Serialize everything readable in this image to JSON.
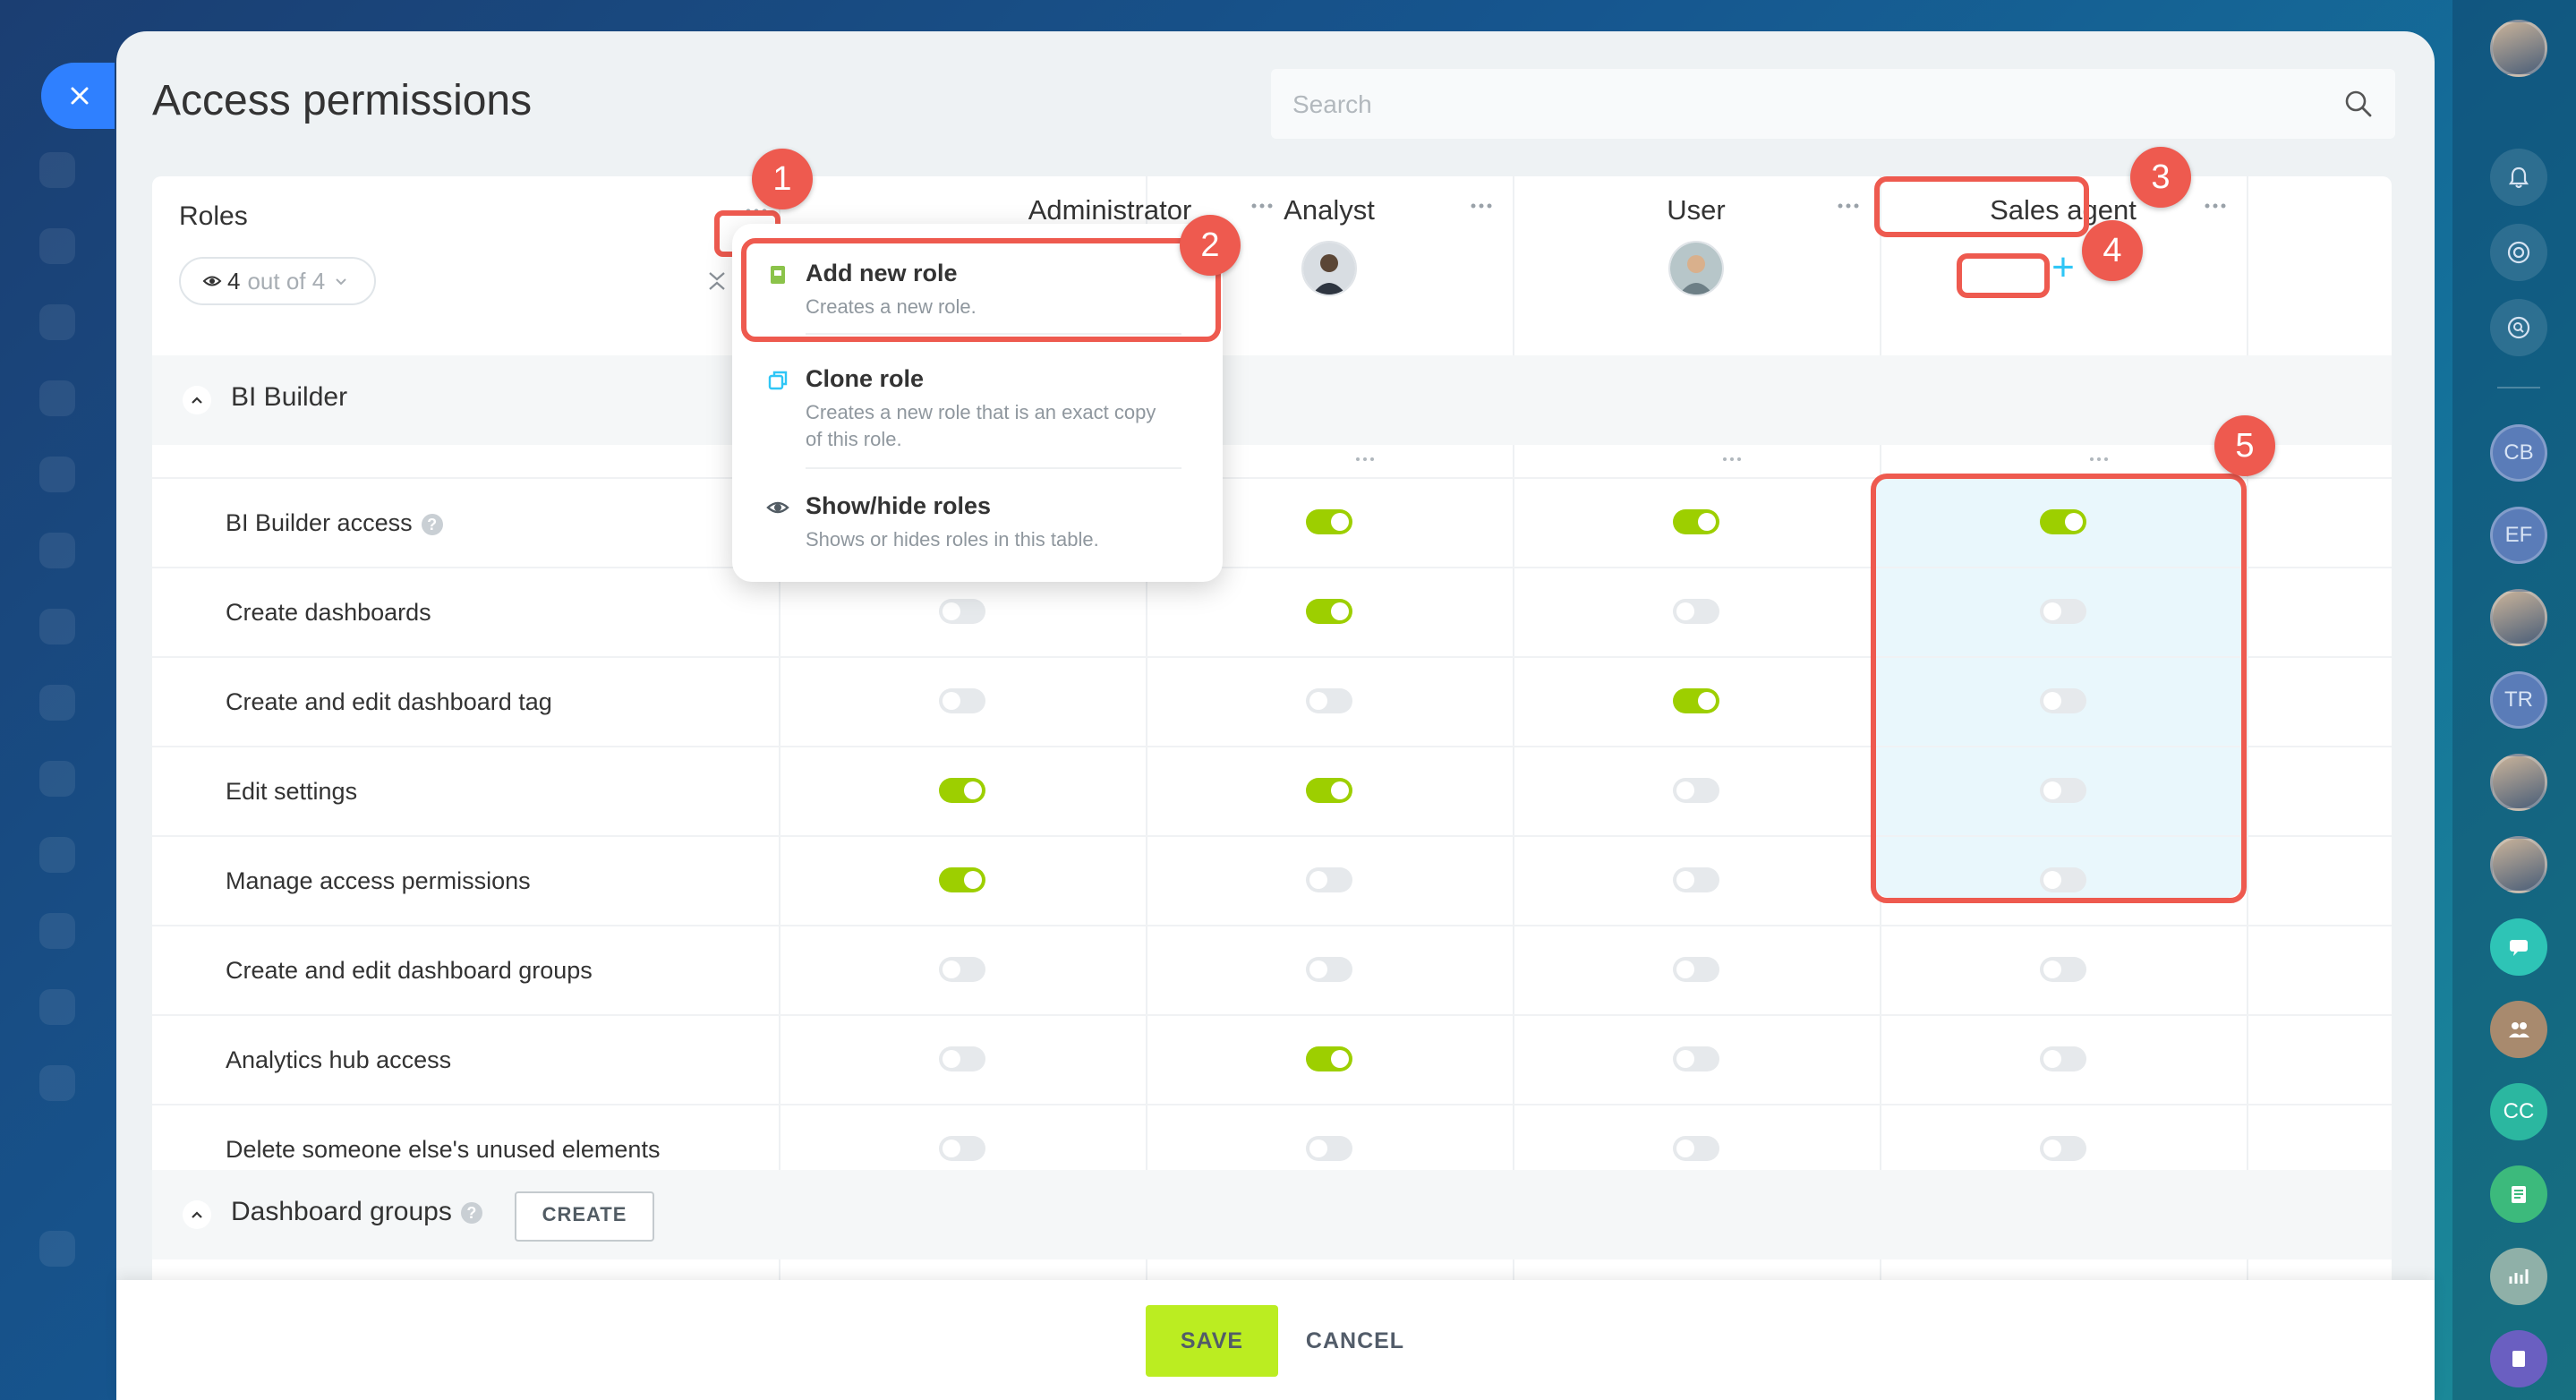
{
  "page": {
    "title": "Access permissions"
  },
  "search": {
    "placeholder": "Search"
  },
  "roles_header": {
    "label": "Roles",
    "count_num": "4",
    "count_rest": "out of 4"
  },
  "columns": [
    {
      "name": "Administrator"
    },
    {
      "name": "Analyst"
    },
    {
      "name": "User"
    },
    {
      "name": "Sales agent"
    }
  ],
  "menu": {
    "items": [
      {
        "title": "Add new role",
        "desc": "Creates a new role.",
        "icon": "add-role-icon"
      },
      {
        "title": "Clone role",
        "desc": "Creates a new role that is an exact copy of this role.",
        "icon": "clone-icon"
      },
      {
        "title": "Show/hide roles",
        "desc": "Shows or hides roles in this table.",
        "icon": "eye-icon"
      }
    ]
  },
  "sections": [
    {
      "label": "BI Builder"
    },
    {
      "label": "Dashboard groups",
      "create_label": "CREATE"
    }
  ],
  "permissions": [
    {
      "label": "BI Builder access",
      "help": "?",
      "values": [
        null,
        true,
        true,
        true
      ]
    },
    {
      "label": "Create dashboards",
      "values": [
        false,
        true,
        false,
        false
      ]
    },
    {
      "label": "Create and edit dashboard tag",
      "values": [
        false,
        false,
        true,
        false
      ]
    },
    {
      "label": "Edit settings",
      "values": [
        true,
        true,
        false,
        false
      ]
    },
    {
      "label": "Manage access permissions",
      "values": [
        true,
        false,
        false,
        false
      ]
    },
    {
      "label": "Create and edit dashboard groups",
      "values": [
        false,
        false,
        false,
        false
      ]
    },
    {
      "label": "Analytics hub access",
      "values": [
        false,
        true,
        false,
        false
      ]
    },
    {
      "label": "Delete someone else's unused elements",
      "values": [
        false,
        false,
        false,
        false
      ]
    }
  ],
  "callouts": [
    "1",
    "2",
    "3",
    "4",
    "5"
  ],
  "footer": {
    "save_label": "SAVE",
    "cancel_label": "CANCEL"
  },
  "right_rail": {
    "initials": [
      "CB",
      "EF",
      "TR",
      "CC"
    ]
  },
  "colors": {
    "toggle_on": "#9dcf00",
    "highlight": "#ee5a4f",
    "save": "#bbed21",
    "accent": "#2fc6f6"
  }
}
